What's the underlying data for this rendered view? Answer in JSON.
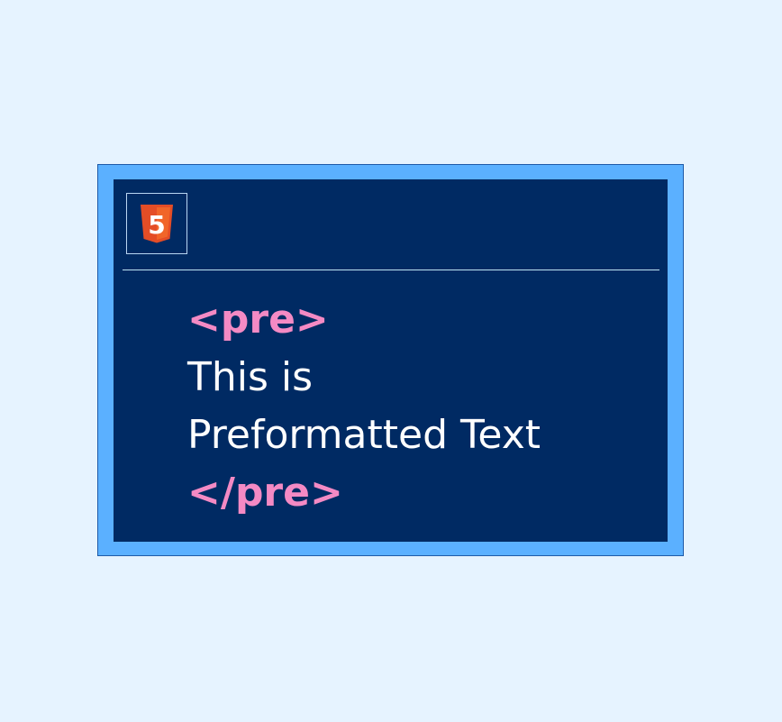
{
  "colors": {
    "page_background": "#e6f3ff",
    "frame": "#5bb0ff",
    "panel": "#002a63",
    "tag": "#f48ac4",
    "text": "#ffffff",
    "logo_orange": "#e44d26",
    "logo_orange_light": "#f16529"
  },
  "logo": {
    "icon": "html5-icon",
    "glyph": "5"
  },
  "code": {
    "open_tag": "<pre>",
    "line1": "This is",
    "line2": "Preformatted Text",
    "close_tag": "</pre>"
  }
}
